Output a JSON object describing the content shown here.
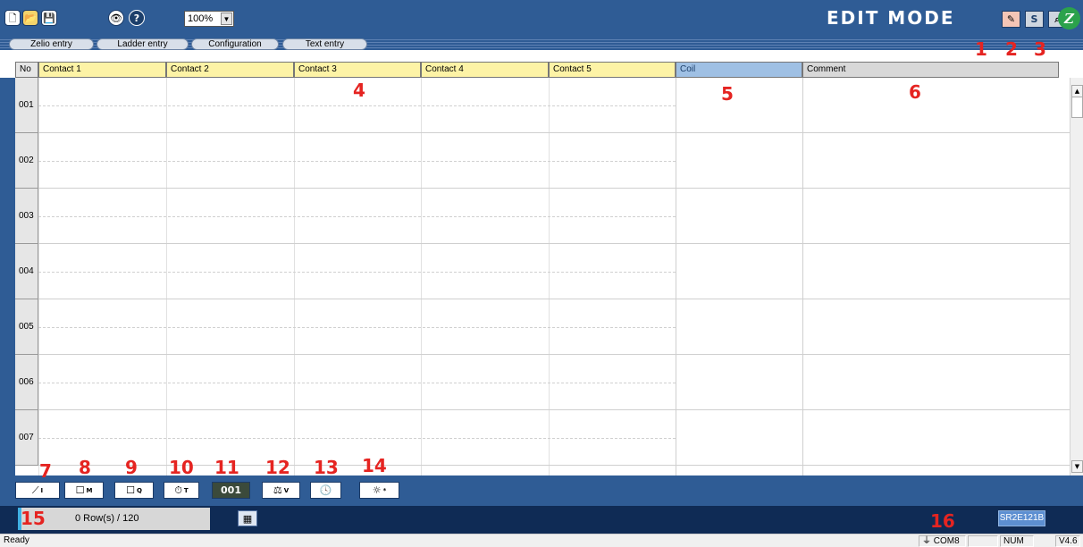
{
  "toolbar": {
    "new_icon": "new-file-icon",
    "open_icon": "open-folder-icon",
    "save_icon": "save-disk-icon",
    "view_icon": "view-eye-icon",
    "help_icon": "help-icon",
    "zoom_value": "100%",
    "mode_title": "EDIT MODE",
    "mode_buttons": [
      "edit-mode-icon",
      "S",
      "search-icon"
    ]
  },
  "tabs": [
    "Zelio entry",
    "Ladder entry",
    "Configuration",
    "Text entry"
  ],
  "callouts": [
    "1",
    "2",
    "3",
    "4",
    "5",
    "6",
    "7",
    "8",
    "9",
    "10",
    "11",
    "12",
    "13",
    "14",
    "15",
    "16"
  ],
  "grid": {
    "headers": {
      "no": "No",
      "contacts": [
        "Contact 1",
        "Contact 2",
        "Contact 3",
        "Contact 4",
        "Contact 5"
      ],
      "coil": "Coil",
      "comment": "Comment"
    },
    "rows": [
      "001",
      "002",
      "003",
      "004",
      "005",
      "006",
      "007"
    ]
  },
  "tools": [
    {
      "icon": "contact-icon",
      "glyph": "⟋",
      "sup": "I"
    },
    {
      "icon": "memory-relay-icon",
      "glyph": "☐",
      "sup": "M"
    },
    {
      "icon": "output-coil-icon",
      "glyph": "☐",
      "sup": "Q"
    },
    {
      "icon": "timer-icon",
      "glyph": "⏱",
      "sup": "T"
    },
    {
      "icon": "counter-icon",
      "glyph": "001",
      "sup": ""
    },
    {
      "icon": "comparator-icon",
      "glyph": "⚖",
      "sup": "V"
    },
    {
      "icon": "clock-icon",
      "glyph": "🕓",
      "sup": ""
    },
    {
      "icon": "summer-winter-icon",
      "glyph": "☼",
      "sup": "*"
    }
  ],
  "status": {
    "row_count": "0 Row(s) / 120",
    "model": "SR2E121B",
    "ready": "Ready",
    "port": "COM8",
    "num": "NUM",
    "version": "V4.6"
  },
  "colors": {
    "frame": "#2f5c95",
    "callout": "#e52421",
    "contact_header": "#fdf3a6",
    "coil_header": "#9fc0e4"
  }
}
